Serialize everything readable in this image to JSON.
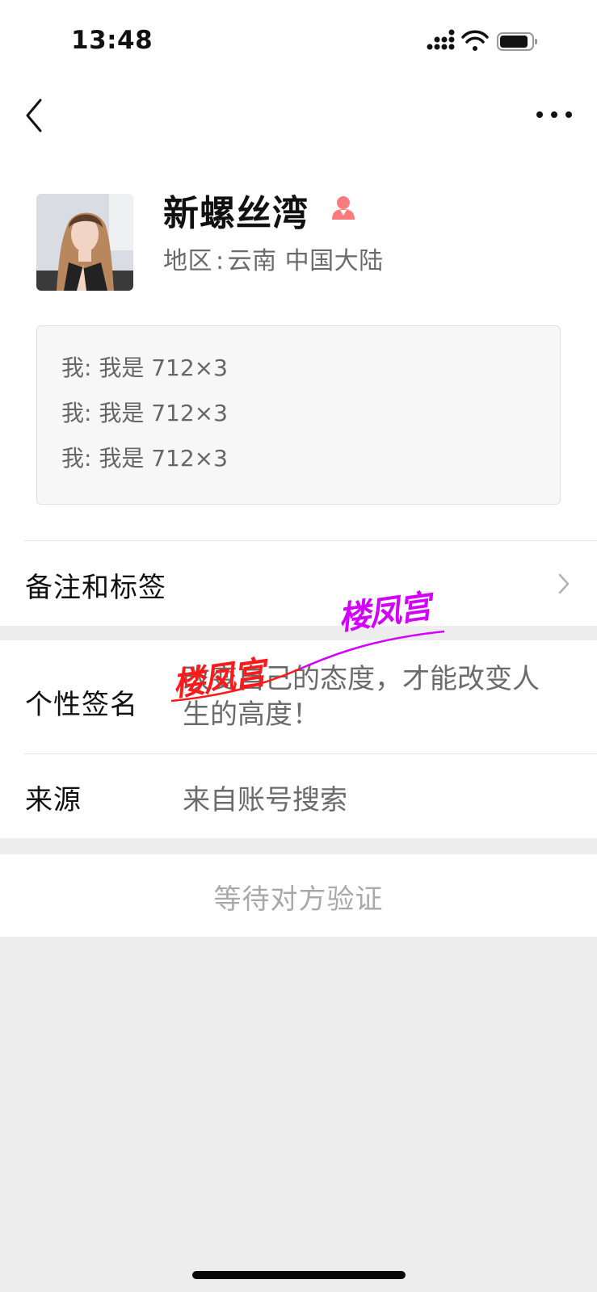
{
  "status_bar": {
    "time": "13:48",
    "icons": [
      "signal-icon",
      "wifi-icon",
      "battery-icon"
    ]
  },
  "nav": {
    "back_icon": "chevron-left-icon",
    "more_icon": "more-icon"
  },
  "profile": {
    "name": "新螺丝湾",
    "gender_icon": "female-icon",
    "gender_color": "#fa5151",
    "region_label": "地区",
    "region_colon": ":",
    "region_value": "云南 中国大陆"
  },
  "messages": [
    "我: 我是 712×3",
    "我: 我是 712×3",
    "我: 我是 712×3"
  ],
  "remarks": {
    "label": "备注和标签"
  },
  "signature": {
    "label": "个性签名",
    "value": "改变自己的态度，才能改变人生的高度！"
  },
  "source": {
    "label": "来源",
    "value": "来自账号搜索"
  },
  "action": {
    "label": "等待对方验证"
  },
  "watermarks": {
    "red": "楼凤宫",
    "magenta": "楼凤宫",
    "red_color": "#ff1a1a",
    "magenta_color": "#d400ff"
  },
  "colors": {
    "background": "#ededed",
    "card": "#ffffff",
    "secondary_text": "#6b6b6b",
    "disabled_text": "#a9a9a9"
  }
}
